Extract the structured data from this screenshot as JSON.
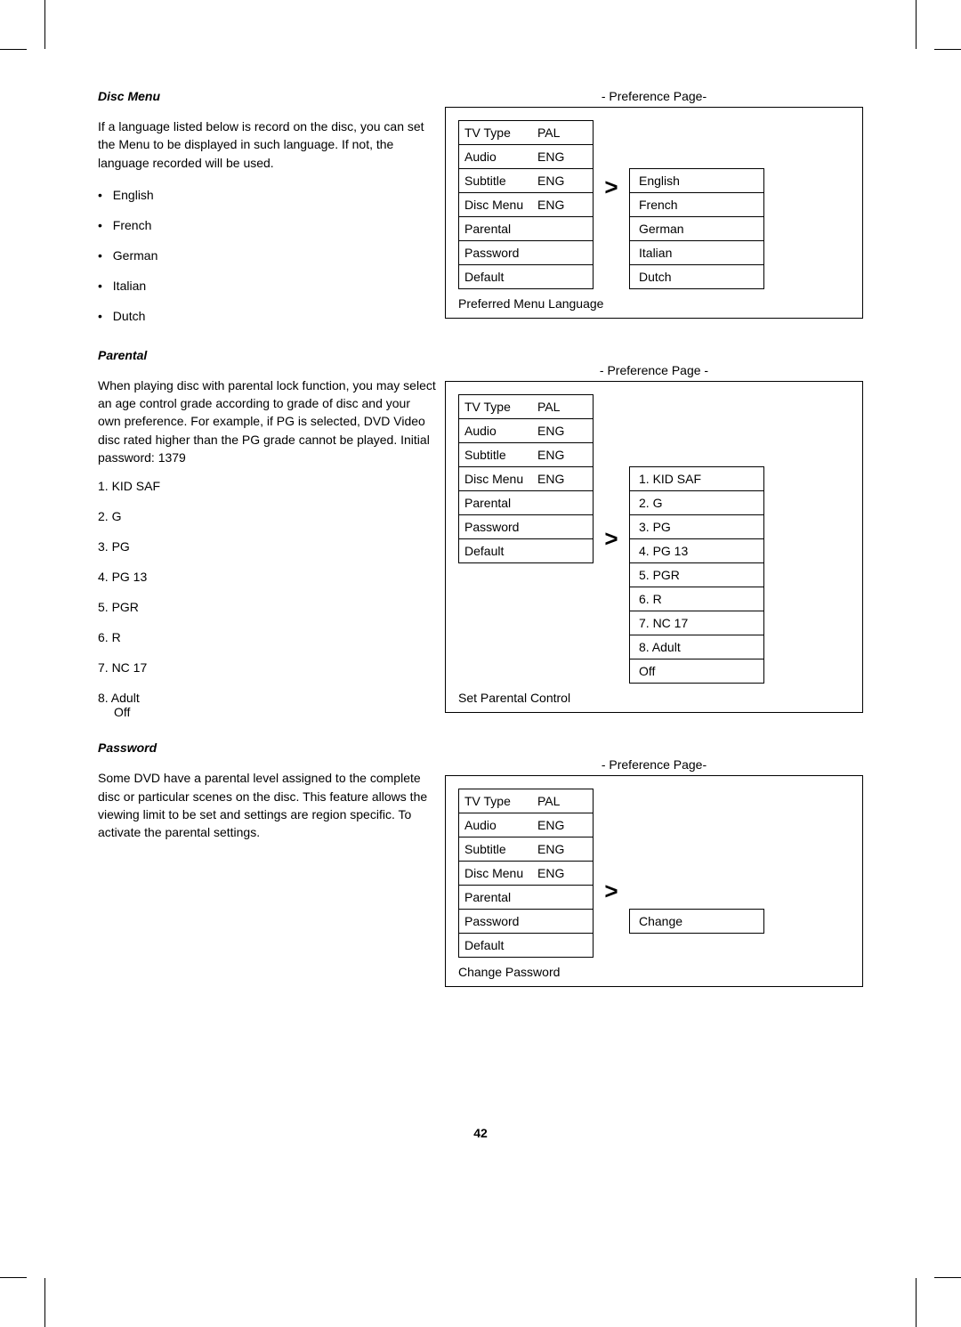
{
  "sections": {
    "disc_menu": {
      "heading": "Disc Menu",
      "para": "If a language listed below is record on the disc, you can set the Menu to be displayed in such language. If not, the language recorded will be used.",
      "bullets": [
        "English",
        "French",
        "German",
        "Italian",
        "Dutch"
      ]
    },
    "parental": {
      "heading": "Parental",
      "para": "When playing disc with parental lock function, you may select an age control grade according to grade of disc and your own preference. For example, if PG is selected, DVD Video disc rated higher than the PG grade cannot be played. Initial password: 1379",
      "items": [
        "1. KID SAF",
        "2. G",
        "3. PG",
        "4. PG 13",
        "5. PGR",
        "6. R",
        "7. NC 17",
        "8. Adult"
      ],
      "off": "Off"
    },
    "password": {
      "heading": "Password",
      "para": "Some DVD have a parental level assigned to the complete disc or particular scenes on the disc. This feature allows the viewing limit to be set and settings are region specific. To activate the parental settings."
    }
  },
  "panel1": {
    "title": "- Preference Page-",
    "menu": [
      {
        "label": "TV Type",
        "value": "PAL"
      },
      {
        "label": "Audio",
        "value": "ENG"
      },
      {
        "label": "Subtitle",
        "value": "ENG"
      },
      {
        "label": "Disc Menu",
        "value": "ENG"
      },
      {
        "label": "Parental",
        "value": ""
      },
      {
        "label": "Password",
        "value": ""
      },
      {
        "label": "Default",
        "value": ""
      }
    ],
    "sub": [
      "English",
      "French",
      "German",
      "Italian",
      "Dutch"
    ],
    "footer": "Preferred Menu Language"
  },
  "panel2": {
    "title": "- Preference Page -",
    "menu": [
      {
        "label": "TV Type",
        "value": "PAL"
      },
      {
        "label": "Audio",
        "value": "ENG"
      },
      {
        "label": "Subtitle",
        "value": "ENG"
      },
      {
        "label": "Disc Menu",
        "value": "ENG"
      },
      {
        "label": "Parental",
        "value": ""
      },
      {
        "label": "Password",
        "value": ""
      },
      {
        "label": "Default",
        "value": ""
      }
    ],
    "sub": [
      "1.  KID SAF",
      "2.  G",
      "3.  PG",
      "4.  PG 13",
      "5.  PGR",
      "6.  R",
      "7.  NC 17",
      "8.  Adult",
      "Off"
    ],
    "footer": "Set Parental Control"
  },
  "panel3": {
    "title": "- Preference Page-",
    "menu": [
      {
        "label": "TV Type",
        "value": "PAL"
      },
      {
        "label": "Audio",
        "value": "ENG"
      },
      {
        "label": "Subtitle",
        "value": "ENG"
      },
      {
        "label": "Disc Menu",
        "value": "ENG"
      },
      {
        "label": "Parental",
        "value": ""
      },
      {
        "label": "Password",
        "value": ""
      },
      {
        "label": "Default",
        "value": ""
      }
    ],
    "sub": [
      "Change"
    ],
    "footer": "Change Password"
  },
  "page_number": "42",
  "arrow_glyph": ">"
}
